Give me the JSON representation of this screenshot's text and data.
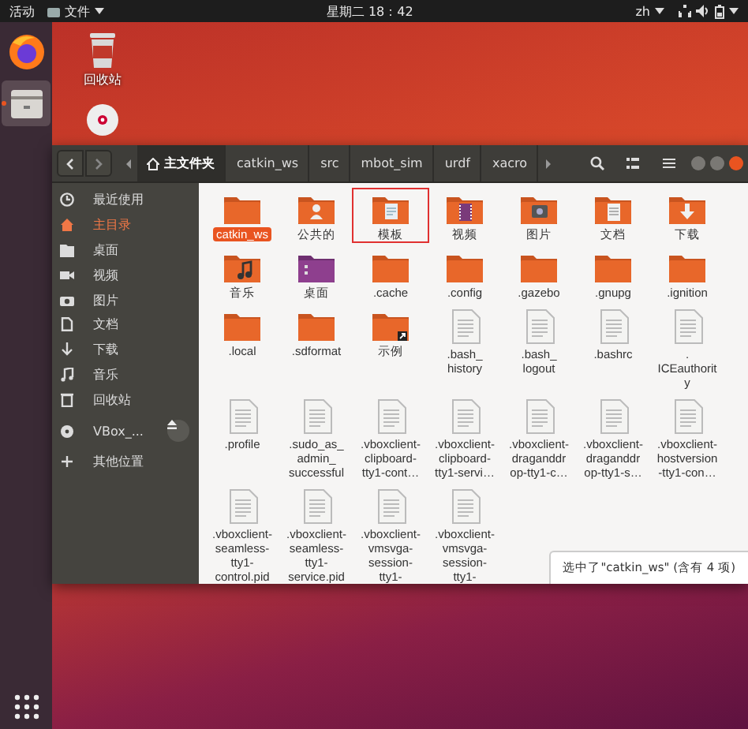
{
  "top_bar": {
    "activities": "活动",
    "app_menu": "文件",
    "clock": "星期二 18：42",
    "input_method": "zh"
  },
  "dock": {
    "apps": [
      {
        "kind": "browser",
        "running": false
      },
      {
        "kind": "files",
        "running": true
      }
    ]
  },
  "desktop": {
    "icons": [
      {
        "kind": "trash",
        "label": "回收站"
      },
      {
        "kind": "disc"
      }
    ]
  },
  "window": {
    "path": [
      {
        "kind": "home",
        "label": "主文件夹",
        "selected": true
      },
      {
        "kind": "folder",
        "label": "catkin_ws",
        "selected": false
      },
      {
        "kind": "folder",
        "label": "src",
        "selected": false
      },
      {
        "kind": "folder",
        "label": "mbot_sim",
        "selected": false
      },
      {
        "kind": "folder",
        "label": "urdf",
        "selected": false
      },
      {
        "kind": "folder",
        "label": "xacro",
        "selected": false
      }
    ],
    "sidebar": {
      "items": [
        {
          "kind": "recent",
          "label": "最近使用",
          "selected": false
        },
        {
          "kind": "home",
          "label": "主目录",
          "selected": true
        },
        {
          "kind": "desktop",
          "label": "桌面",
          "selected": false
        },
        {
          "kind": "videos",
          "label": "视频",
          "selected": false
        },
        {
          "kind": "pictures",
          "label": "图片",
          "selected": false
        },
        {
          "kind": "documents",
          "label": "文档",
          "selected": false
        },
        {
          "kind": "downloads",
          "label": "下载",
          "selected": false
        },
        {
          "kind": "music",
          "label": "音乐",
          "selected": false
        },
        {
          "kind": "trash",
          "label": "回收站",
          "selected": false
        },
        {
          "kind": "drive",
          "label": "VBox_...",
          "selected": false
        },
        {
          "kind": "other",
          "label": "其他位置",
          "selected": false
        }
      ]
    },
    "files": [
      {
        "kind": "folder",
        "label": "catkin_ws",
        "selected": true,
        "marked": false
      },
      {
        "kind": "public",
        "label": "公共的",
        "selected": false,
        "marked": false
      },
      {
        "kind": "templates",
        "label": "模板",
        "selected": false,
        "marked": true
      },
      {
        "kind": "videos",
        "label": "视频",
        "selected": false,
        "marked": false
      },
      {
        "kind": "pictures",
        "label": "图片",
        "selected": false,
        "marked": false
      },
      {
        "kind": "documents",
        "label": "文档",
        "selected": false,
        "marked": false
      },
      {
        "kind": "downloads",
        "label": "下载",
        "selected": false,
        "marked": false
      },
      {
        "kind": "music",
        "label": "音乐",
        "selected": false,
        "marked": false
      },
      {
        "kind": "desktop",
        "label": "桌面",
        "selected": false,
        "marked": false
      },
      {
        "kind": "folder",
        "label": ".cache",
        "selected": false,
        "marked": false
      },
      {
        "kind": "folder",
        "label": ".config",
        "selected": false,
        "marked": false
      },
      {
        "kind": "folder",
        "label": ".gazebo",
        "selected": false,
        "marked": false
      },
      {
        "kind": "folder",
        "label": ".gnupg",
        "selected": false,
        "marked": false
      },
      {
        "kind": "folder",
        "label": ".ignition",
        "selected": false,
        "marked": false
      },
      {
        "kind": "folder",
        "label": ".local",
        "selected": false,
        "marked": false
      },
      {
        "kind": "folder",
        "label": ".sdformat",
        "selected": false,
        "marked": false
      },
      {
        "kind": "link",
        "label": "示例",
        "selected": false,
        "marked": false
      },
      {
        "kind": "file",
        "label": ".bash_\nhistory",
        "selected": false,
        "marked": false
      },
      {
        "kind": "file",
        "label": ".bash_\nlogout",
        "selected": false,
        "marked": false
      },
      {
        "kind": "file",
        "label": ".bashrc",
        "selected": false,
        "marked": false
      },
      {
        "kind": "file",
        "label": ".\nICEauthorit\ny",
        "selected": false,
        "marked": false
      },
      {
        "kind": "file",
        "label": ".profile",
        "selected": false,
        "marked": false
      },
      {
        "kind": "file",
        "label": ".sudo_as_\nadmin_\nsuccessful",
        "selected": false,
        "marked": false
      },
      {
        "kind": "file",
        "label": ".vboxclient-\nclipboard-\ntty1-cont…",
        "selected": false,
        "marked": false
      },
      {
        "kind": "file",
        "label": ".vboxclient-\nclipboard-\ntty1-servi…",
        "selected": false,
        "marked": false
      },
      {
        "kind": "file",
        "label": ".vboxclient-\ndraganddr\nop-tty1-c…",
        "selected": false,
        "marked": false
      },
      {
        "kind": "file",
        "label": ".vboxclient-\ndraganddr\nop-tty1-s…",
        "selected": false,
        "marked": false
      },
      {
        "kind": "file",
        "label": ".vboxclient-\nhostversion\n-tty1-con…",
        "selected": false,
        "marked": false
      },
      {
        "kind": "file",
        "label": ".vboxclient-\nseamless-\ntty1-\ncontrol.pid",
        "selected": false,
        "marked": false
      },
      {
        "kind": "file",
        "label": ".vboxclient-\nseamless-\ntty1-\nservice.pid",
        "selected": false,
        "marked": false
      },
      {
        "kind": "file",
        "label": ".vboxclient-\nvmsvga-\nsession-\ntty1-",
        "selected": false,
        "marked": false
      },
      {
        "kind": "file",
        "label": ".vboxclient-\nvmsvga-\nsession-\ntty1-",
        "selected": false,
        "marked": false
      }
    ],
    "status": "选中了\"catkin_ws\" (含有 4 项)"
  }
}
